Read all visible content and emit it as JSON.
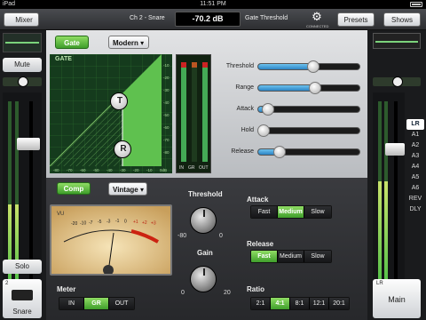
{
  "status": {
    "carrier": "iPad",
    "time": "11:51 PM",
    "battery": ""
  },
  "header": {
    "back_label": "Mixer",
    "channel": "Ch 2 - Snare",
    "value": "-70.2 dB",
    "param": "Gate Threshold",
    "connected": "CONNECTED",
    "presets_label": "Presets",
    "shows_label": "Shows"
  },
  "left_strip": {
    "mute": "Mute",
    "solo": "Solo",
    "channel_num": "2",
    "channel_name": "Snare",
    "meter_level": 0.42,
    "fader_level": 0.78,
    "pan": 0.5
  },
  "right_strip": {
    "buses": [
      "LR",
      "A1",
      "A2",
      "A3",
      "A4",
      "A5",
      "A6",
      "REV",
      "DLY"
    ],
    "selected_bus": "LR",
    "main_num": "LR",
    "main_label": "Main",
    "fader_level": 0.75
  },
  "gate": {
    "enable_label": "Gate",
    "type": "Modern",
    "title": "GATE",
    "knob_t": "T",
    "knob_r": "R",
    "x_ticks": [
      "-80",
      "-70",
      "-60",
      "-50",
      "-40",
      "-30",
      "-20",
      "-10",
      "0dB"
    ],
    "y_ticks": [
      "-10",
      "-20",
      "-30",
      "-40",
      "-50",
      "-60",
      "-70",
      "-80"
    ],
    "meter_in_label": "IN",
    "meter_gr_label": "GR",
    "meter_out_label": "OUT",
    "params": [
      {
        "label": "Threshold",
        "value": 0.55
      },
      {
        "label": "Range",
        "value": 0.57
      },
      {
        "label": "Attack",
        "value": 0.05
      },
      {
        "label": "Hold",
        "value": 0.0
      },
      {
        "label": "Release",
        "value": 0.18
      }
    ]
  },
  "comp": {
    "enable_label": "Comp",
    "type": "Vintage",
    "vu_label": "VU",
    "vu_ticks": [
      "-20",
      "-10",
      "-7",
      "-5",
      "-3",
      "-1",
      "0",
      "+1",
      "+2",
      "+3"
    ],
    "threshold_label": "Threshold",
    "threshold_min": "-80",
    "threshold_max": "0",
    "gain_label": "Gain",
    "gain_min": "0",
    "gain_max": "20",
    "attack_label": "Attack",
    "attack_opts": [
      "Fast",
      "Medium",
      "Slow"
    ],
    "attack_sel": 1,
    "release_label": "Release",
    "release_opts": [
      "Fast",
      "Medium",
      "Slow"
    ],
    "release_sel": 0,
    "ratio_label": "Ratio",
    "ratio_opts": [
      "2:1",
      "4:1",
      "8:1",
      "12:1",
      "20:1"
    ],
    "ratio_sel": 1,
    "meter_label": "Meter",
    "meter_opts": [
      "IN",
      "GR",
      "OUT"
    ],
    "meter_sel": 1
  }
}
